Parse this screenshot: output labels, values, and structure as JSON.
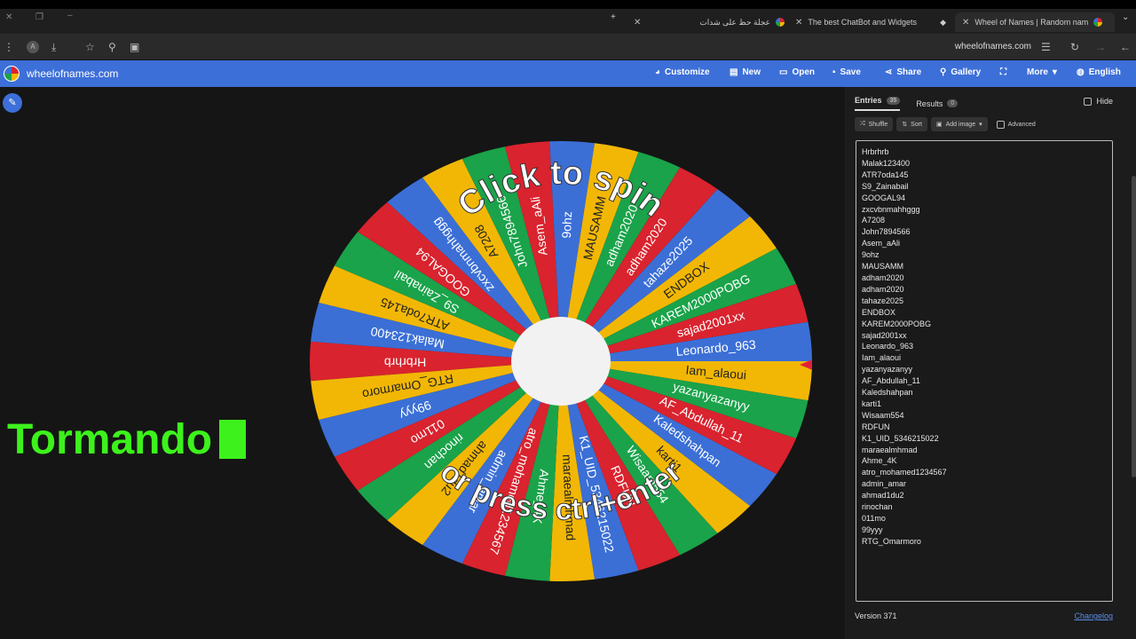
{
  "browser": {
    "tabs": [
      {
        "title": "عجلة حظ على شدات",
        "active": false
      },
      {
        "title": "The best ChatBot and Widgets",
        "active": false
      },
      {
        "title": "Wheel of Names | Random nam",
        "active": true
      }
    ],
    "url": "wheelofnames.com"
  },
  "app": {
    "site_name": "wheelofnames.com",
    "nav": [
      {
        "label": "Customize",
        "icon": "palette-icon"
      },
      {
        "label": "New",
        "icon": "file-icon"
      },
      {
        "label": "Open",
        "icon": "folder-icon"
      },
      {
        "label": "Save",
        "icon": "save-icon"
      },
      {
        "label": "Share",
        "icon": "share-icon"
      },
      {
        "label": "Gallery",
        "icon": "search-icon"
      },
      {
        "label": "More",
        "icon": "chevron-down-icon"
      },
      {
        "label": "English",
        "icon": "globe-icon"
      }
    ]
  },
  "overlay_text": "Tormando",
  "wheel": {
    "center_text_top": "Click to spin",
    "center_text_bottom": "or press ctrl+enter",
    "colors": [
      "#d9232e",
      "#3b6fd6",
      "#f2b705",
      "#1aa34a"
    ],
    "slices": [
      "Hrbrhrb",
      "Malak123400",
      "ATR7oda145",
      "S9_Zainabail",
      "GOOGAL94",
      "zxcvbnmahhggg",
      "A7208",
      "John7894566",
      "Asem_aAli",
      "9ohz",
      "MAUSAMM",
      "adham2020",
      "adham2020",
      "tahaze2025",
      "ENDBOX",
      "KAREM2000POBG",
      "sajad2001xx",
      "Leonardo_963",
      "Iam_alaoui",
      "yazanyazanyy",
      "AF_Abdullah_11",
      "Kaledshahpan",
      "karti1",
      "Wisaam554",
      "RDFUN",
      "K1_UID_5346215022",
      "maraealmhmad",
      "Ahme_4K",
      "atro_mohamed1234567",
      "admin_amar",
      "ahmad1du2",
      "rinochan",
      "011mo",
      "99yyy",
      "RTG_Omarmoro"
    ]
  },
  "panel": {
    "tabs": [
      {
        "label": "Entries",
        "count": "35"
      },
      {
        "label": "Results",
        "count": "0"
      }
    ],
    "hide_label": "Hide",
    "tools": {
      "shuffle": "Shuffle",
      "sort": "Sort",
      "add_image": "Add image",
      "advanced": "Advanced"
    },
    "entries": [
      "Hrbrhrb",
      "Malak123400",
      "ATR7oda145",
      "S9_Zainabail",
      "GOOGAL94",
      "zxcvbnmahhggg",
      "A7208",
      "John7894566",
      "Asem_aAli",
      "9ohz",
      "MAUSAMM",
      "adham2020",
      "adham2020",
      "tahaze2025",
      "ENDBOX",
      "KAREM2000POBG",
      "sajad2001xx",
      "Leonardo_963",
      "Iam_alaoui",
      "yazanyazanyy",
      "AF_Abdullah_11",
      "Kaledshahpan",
      "karti1",
      "Wisaam554",
      "RDFUN",
      "K1_UID_5346215022",
      "maraealmhmad",
      "Ahme_4K",
      "atro_mohamed1234567",
      "admin_amar",
      "ahmad1du2",
      "rinochan",
      "011mo",
      "99yyy",
      "RTG_Omarmoro"
    ],
    "version": "Version 371",
    "changelog": "Changelog"
  }
}
